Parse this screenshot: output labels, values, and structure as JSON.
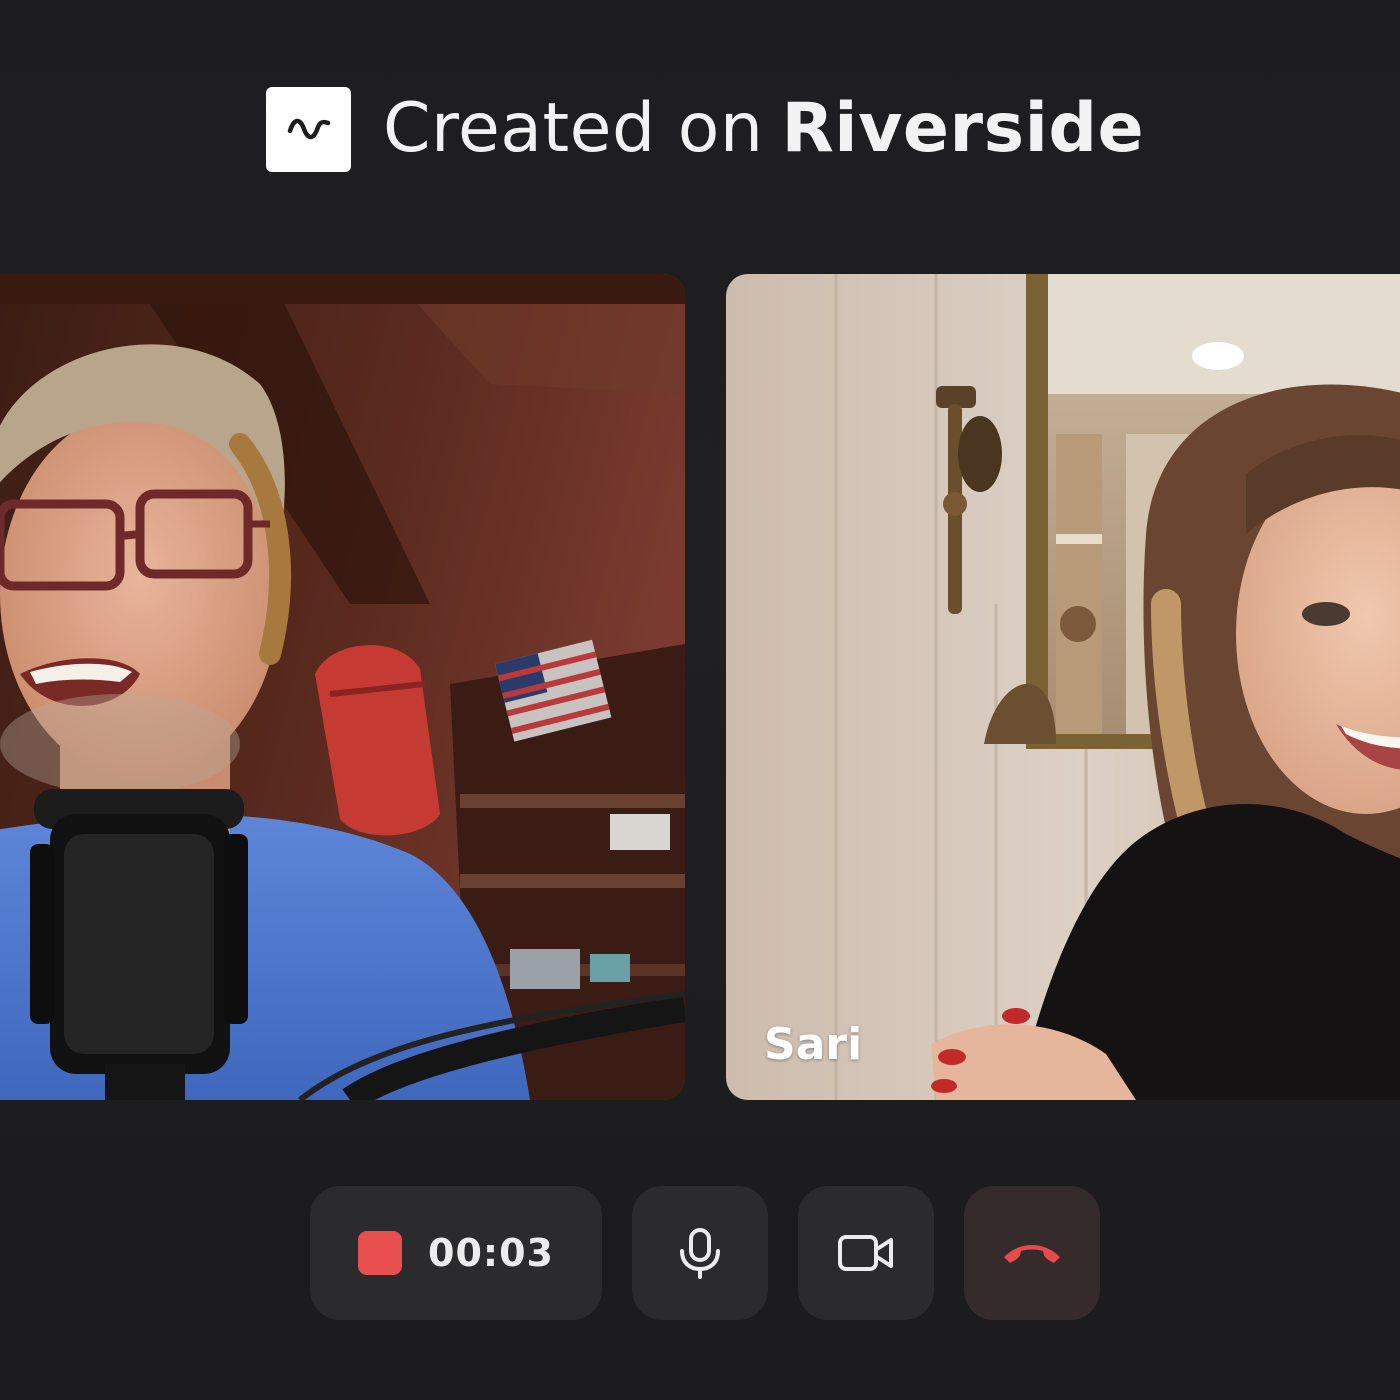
{
  "header": {
    "logo_icon": "riverside-wave-icon",
    "prefix": "Created on",
    "brand": "Riverside"
  },
  "participants": [
    {
      "id": "host",
      "name": "",
      "scene": "man with glasses at microphone, garage background"
    },
    {
      "id": "guest",
      "name": "Sari"
    }
  ],
  "controls": {
    "record_icon": "record-stop-icon",
    "timer": "00:03",
    "mic_icon": "microphone-icon",
    "camera_icon": "video-camera-icon",
    "hangup_icon": "hang-up-phone-icon"
  },
  "colors": {
    "background": "#1e1e20",
    "control_bg": "#2b2b2d",
    "record": "#e8504f",
    "hangup": "#e64a4a"
  }
}
